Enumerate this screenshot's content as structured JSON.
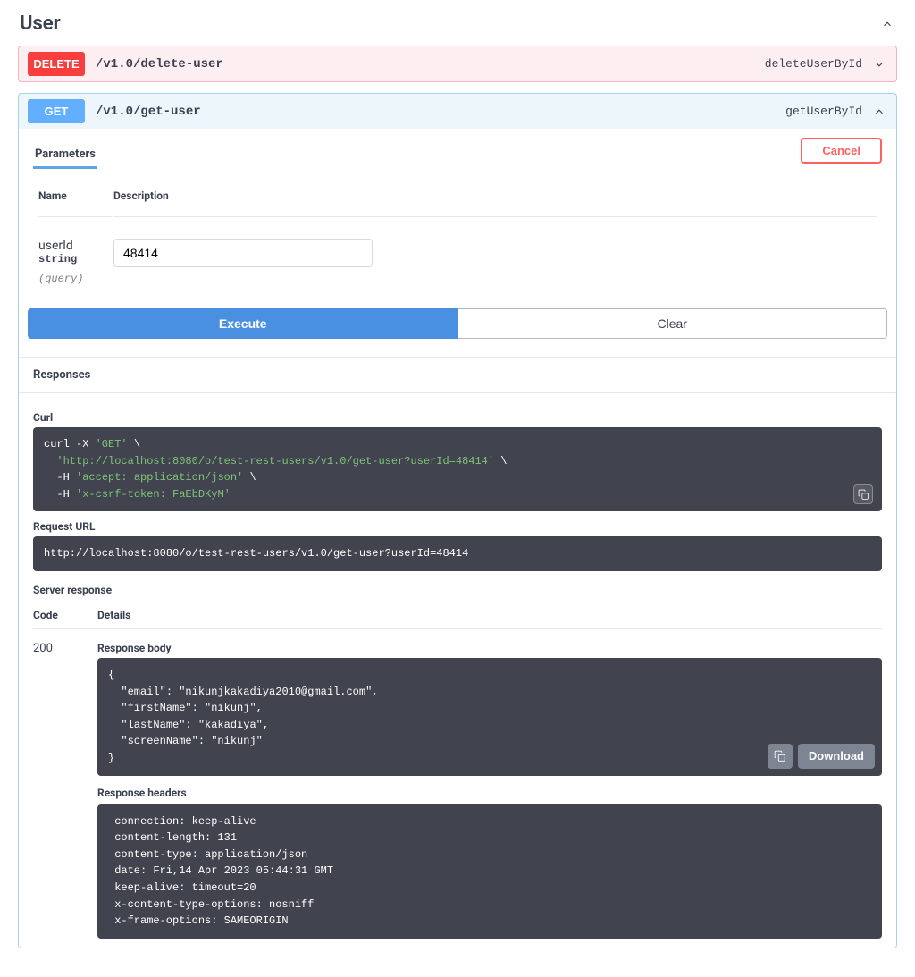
{
  "section": {
    "title": "User"
  },
  "delete_op": {
    "method": "DELETE",
    "path": "/v1.0/delete-user",
    "opId": "deleteUserById"
  },
  "get_op": {
    "method": "GET",
    "path": "/v1.0/get-user",
    "opId": "getUserById"
  },
  "params": {
    "tab_label": "Parameters",
    "cancel_label": "Cancel",
    "col_name": "Name",
    "col_desc": "Description",
    "param_name": "userId",
    "param_type": "string",
    "param_in": "(query)",
    "param_value": "48414"
  },
  "actions": {
    "execute": "Execute",
    "clear": "Clear"
  },
  "responses": {
    "header": "Responses",
    "curl_label": "Curl",
    "curl_line1_a": "curl -X ",
    "curl_line1_b": "'GET'",
    "curl_line1_c": " \\",
    "curl_line2_a": "  ",
    "curl_line2_b": "'http://localhost:8080/o/test-rest-users/v1.0/get-user?userId=48414'",
    "curl_line2_c": " \\",
    "curl_line3_a": "  -H ",
    "curl_line3_b": "'accept: application/json'",
    "curl_line3_c": " \\",
    "curl_line4_a": "  -H ",
    "curl_line4_b": "'x-csrf-token: FaEbDKyM'",
    "req_url_label": "Request URL",
    "req_url": "http://localhost:8080/o/test-rest-users/v1.0/get-user?userId=48414",
    "server_resp_label": "Server response",
    "col_code": "Code",
    "col_details": "Details",
    "code": "200",
    "body_label": "Response body",
    "body_open": "{",
    "body_email_k": "\"email\"",
    "body_email_v": "\"nikunjkakadiya2010@gmail.com\"",
    "body_first_k": "\"firstName\"",
    "body_first_v": "\"nikunj\"",
    "body_last_k": "\"lastName\"",
    "body_last_v": "\"kakadiya\"",
    "body_screen_k": "\"screenName\"",
    "body_screen_v": "\"nikunj\"",
    "body_close": "}",
    "download": "Download",
    "headers_label": "Response headers",
    "hdr1": " connection: keep-alive ",
    "hdr2": " content-length: 131 ",
    "hdr3": " content-type: application/json ",
    "hdr4": " date: Fri,14 Apr 2023 05:44:31 GMT ",
    "hdr5": " keep-alive: timeout=20 ",
    "hdr6": " x-content-type-options: nosniff ",
    "hdr7": " x-frame-options: SAMEORIGIN "
  }
}
